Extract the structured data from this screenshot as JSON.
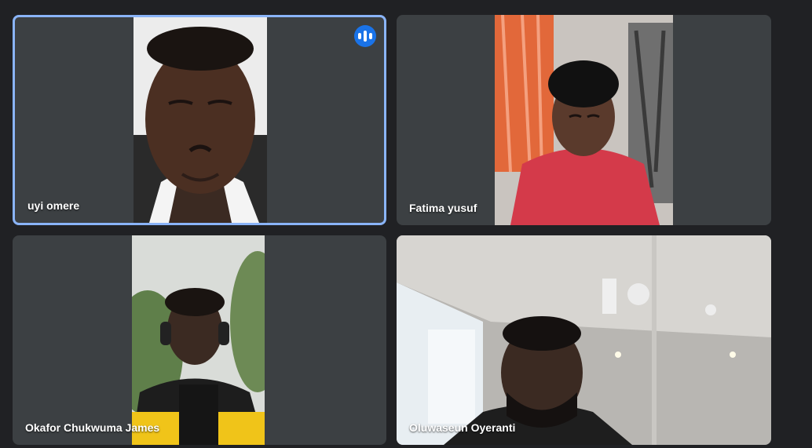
{
  "participants": [
    {
      "name": "uyi omere",
      "speaking": true,
      "speaking_icon": "audio-levels-icon"
    },
    {
      "name": "Fatima yusuf",
      "speaking": false
    },
    {
      "name": "Okafor Chukwuma James",
      "speaking": false
    },
    {
      "name": "Oluwaseun Oyeranti",
      "speaking": false
    }
  ],
  "colors": {
    "background": "#202124",
    "tile": "#3c4043",
    "active_border": "#8ab4f8",
    "speaking_badge": "#1a73e8"
  }
}
